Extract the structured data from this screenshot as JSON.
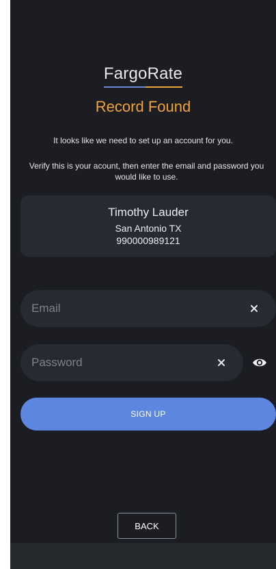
{
  "brand": {
    "logo_text": "FargoRate",
    "accent_colors": {
      "blue": "#6d87d6",
      "orange": "#e9a43c"
    }
  },
  "header": {
    "title": "Record Found"
  },
  "messages": {
    "setup_notice": "It looks like we need to set up an account for you.",
    "verify_instructions": "Verify this is your acount, then enter the email and password you would like to use."
  },
  "record": {
    "name": "Timothy Lauder",
    "location": "San Antonio TX",
    "id_number": "990000989121"
  },
  "form": {
    "email": {
      "value": "",
      "placeholder": "Email",
      "clear_icon": "close-icon"
    },
    "password": {
      "value": "",
      "placeholder": "Password",
      "clear_icon": "close-icon",
      "toggle_icon": "eye-icon"
    },
    "signup_label": "SIGN UP"
  },
  "navigation": {
    "back_label": "BACK"
  },
  "theme": {
    "background": "#1b1d22",
    "card": "#262a31",
    "primary_button": "#5c86e0",
    "headline": "#f2a338"
  }
}
